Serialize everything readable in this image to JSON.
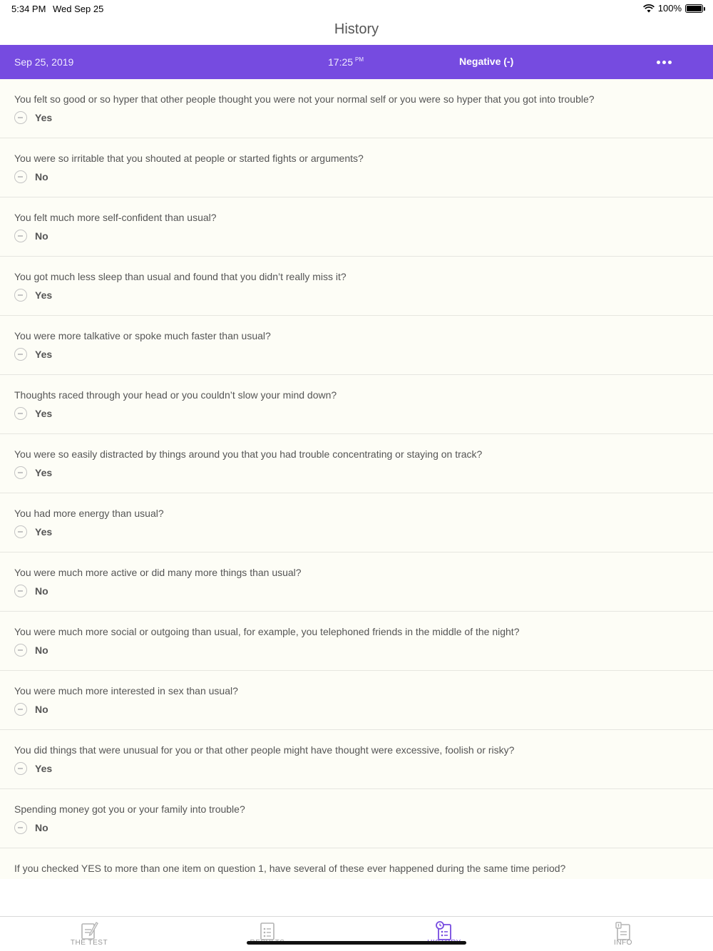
{
  "status_bar": {
    "time": "5:34 PM",
    "date": "Wed Sep 25",
    "battery": "100%"
  },
  "nav": {
    "title": "History"
  },
  "result": {
    "date": "Sep 25, 2019",
    "time": "17:25",
    "meridiem": "PM",
    "verdict": "Negative (-)"
  },
  "questions": [
    {
      "text": "You felt so good or so hyper that other people thought you were not your normal self or you were so hyper that you got into trouble?",
      "answer": "Yes"
    },
    {
      "text": "You were so irritable that you shouted at people or started fights or arguments?",
      "answer": "No"
    },
    {
      "text": "You felt much more self-confident than usual?",
      "answer": "No"
    },
    {
      "text": "You got much less sleep than usual and found that you didn’t really miss it?",
      "answer": "Yes"
    },
    {
      "text": "You were more talkative or spoke much faster than usual?",
      "answer": "Yes"
    },
    {
      "text": "Thoughts raced through your head or you couldn’t slow your mind down?",
      "answer": "Yes"
    },
    {
      "text": "You were so easily distracted by things around you that you had trouble concentrating or staying on track?",
      "answer": "Yes"
    },
    {
      "text": "You had more energy than usual?",
      "answer": "Yes"
    },
    {
      "text": "You were much more active or did many more things than usual?",
      "answer": "No"
    },
    {
      "text": "You were much more social or outgoing than usual, for example, you telephoned friends in the middle of the night?",
      "answer": "No"
    },
    {
      "text": "You were much more interested in sex than usual?",
      "answer": "No"
    },
    {
      "text": "You did things that were unusual for you or that other people might have thought were excessive, foolish or risky?",
      "answer": "Yes"
    },
    {
      "text": "Spending money got you or your family into trouble?",
      "answer": "No"
    },
    {
      "text": "If you checked YES to more than one item on question 1, have several of these ever happened during the same time period?",
      "answer": ""
    }
  ],
  "tabs": [
    {
      "label": "THE TEST",
      "icon": "edit-document-icon"
    },
    {
      "label": "RESULTS",
      "icon": "checklist-icon"
    },
    {
      "label": "HISTORY",
      "icon": "history-icon",
      "active": true
    },
    {
      "label": "INFO",
      "icon": "info-document-icon"
    }
  ],
  "colors": {
    "accent": "#764be0",
    "list_background": "#fdfdf6"
  }
}
